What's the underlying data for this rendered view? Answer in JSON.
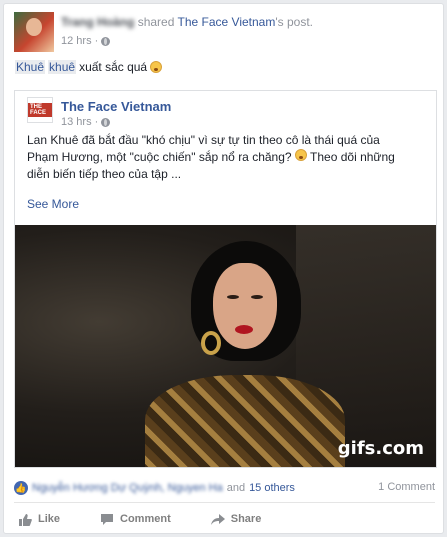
{
  "post": {
    "author": "Trang Hoàng",
    "shared_word": "shared",
    "shared_page": "The Face Vietnam",
    "shared_suffix": "'s post.",
    "time": "12 hrs",
    "status_tag1": "Khuê",
    "status_tag2": "khuê",
    "status_text": "xuất sắc quá"
  },
  "shared": {
    "page_name": "The Face Vietnam",
    "logo_text": "THE FACE",
    "time": "13 hrs",
    "text_line1": "Lan Khuê đã bắt đầu \"khó chịu\" vì sự tự tin theo cô là thái quá của",
    "text_line2": "Phạm Hương, một \"cuộc chiến\" sắp nổ ra chăng?",
    "text_line2_after": "Theo dõi những",
    "text_line3": "diễn biến tiếp theo của tập ...",
    "see_more": "See More",
    "watermark": "gifs.com"
  },
  "footer": {
    "reaction_names": "Nguyễn Hương Dự Quỳnh, Nguyen Ha",
    "reaction_and": "and",
    "reaction_others": "15 others",
    "comments": "1 Comment",
    "like": "Like",
    "comment": "Comment",
    "share": "Share"
  },
  "icons": {
    "privacy": "globe-icon",
    "emoji": "smile-emoji-icon",
    "reaction": "like-reaction-icon"
  },
  "colors": {
    "link": "#365899",
    "meta": "#90949c",
    "like_blue": "#4267b2"
  }
}
